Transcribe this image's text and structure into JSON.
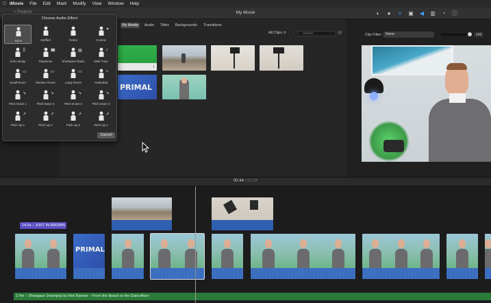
{
  "menubar": {
    "apple": "",
    "items": [
      "iMovie",
      "File",
      "Edit",
      "Mark",
      "Modify",
      "View",
      "Window",
      "Help"
    ]
  },
  "window": {
    "title": "My Movie",
    "projects_link": "< Projects"
  },
  "toolbar_icons": [
    "color-balance-icon",
    "color-correction-icon",
    "crop-icon",
    "stabilization-icon",
    "volume-icon",
    "noise-reduction-icon",
    "speed-icon"
  ],
  "browser": {
    "tabs": [
      {
        "label": "My Media",
        "selected": true
      },
      {
        "label": "Audio",
        "selected": false
      },
      {
        "label": "Titles",
        "selected": false
      },
      {
        "label": "Backgrounds",
        "selected": false
      },
      {
        "label": "Transitions",
        "selected": false
      }
    ],
    "clip_selector": "All Clips ≎",
    "search_placeholder": "Search",
    "primal_label": "PRIMAL",
    "clip_badge": "1"
  },
  "viewer": {
    "clip_filter_label": "Clip Filter:",
    "clip_filter_value": "None",
    "volume_value": "100",
    "volume_level": 1.0
  },
  "timecode": {
    "current": "00:44",
    "separator": "/",
    "total": "02:24"
  },
  "timeline": {
    "title_clip": "14.0s – JUST IN BROWN",
    "primal_label": "PRIMAL",
    "music_clip": "2.4m – Shoegaze Downpop by Rex Banner – From the Beach to the Dancefloor"
  },
  "audio_effect_popover": {
    "title": "Choose Audio Effect",
    "effects": [
      {
        "label": "None",
        "icon": "person-icon",
        "selected": true
      },
      {
        "label": "Muffled",
        "icon": "muffled-person-icon",
        "selected": false
      },
      {
        "label": "Robot",
        "icon": "robot-icon",
        "selected": false
      },
      {
        "label": "Cosmic",
        "icon": "cosmic-icon",
        "selected": false
      },
      {
        "label": "Echo Delay",
        "icon": "echo-delay-icon",
        "selected": false
      },
      {
        "label": "Telephone",
        "icon": "telephone-icon",
        "selected": false
      },
      {
        "label": "Shortwave Radio",
        "icon": "radio-icon",
        "selected": false
      },
      {
        "label": "Multi-Tune",
        "icon": "multi-tune-icon",
        "selected": false
      },
      {
        "label": "Small Room",
        "icon": "small-room-icon",
        "selected": false
      },
      {
        "label": "Medium Room",
        "icon": "medium-room-icon",
        "selected": false
      },
      {
        "label": "Large Room",
        "icon": "large-room-icon",
        "selected": false
      },
      {
        "label": "Cathedral",
        "icon": "cathedral-icon",
        "selected": false
      },
      {
        "label": "Pitch Down 1",
        "icon": "pitch-down-icon",
        "selected": false
      },
      {
        "label": "Pitch Down 2",
        "icon": "pitch-down-icon",
        "selected": false
      },
      {
        "label": "Pitch Down 3",
        "icon": "pitch-down-icon",
        "selected": false
      },
      {
        "label": "Pitch Down 4",
        "icon": "pitch-down-icon",
        "selected": false
      },
      {
        "label": "Pitch Up 1",
        "icon": "pitch-up-icon",
        "selected": false
      },
      {
        "label": "Pitch Up 2",
        "icon": "pitch-up-icon",
        "selected": false
      },
      {
        "label": "Pitch Up 3",
        "icon": "pitch-up-icon",
        "selected": false
      },
      {
        "label": "Pitch Up 4",
        "icon": "pitch-up-icon",
        "selected": false
      }
    ],
    "cancel_label": "Cancel"
  },
  "colors": {
    "accent": "#3aa0ff",
    "title_clip": "#5a4fc2",
    "audio": "#2f5fb0",
    "music": "#2a7a3a"
  }
}
